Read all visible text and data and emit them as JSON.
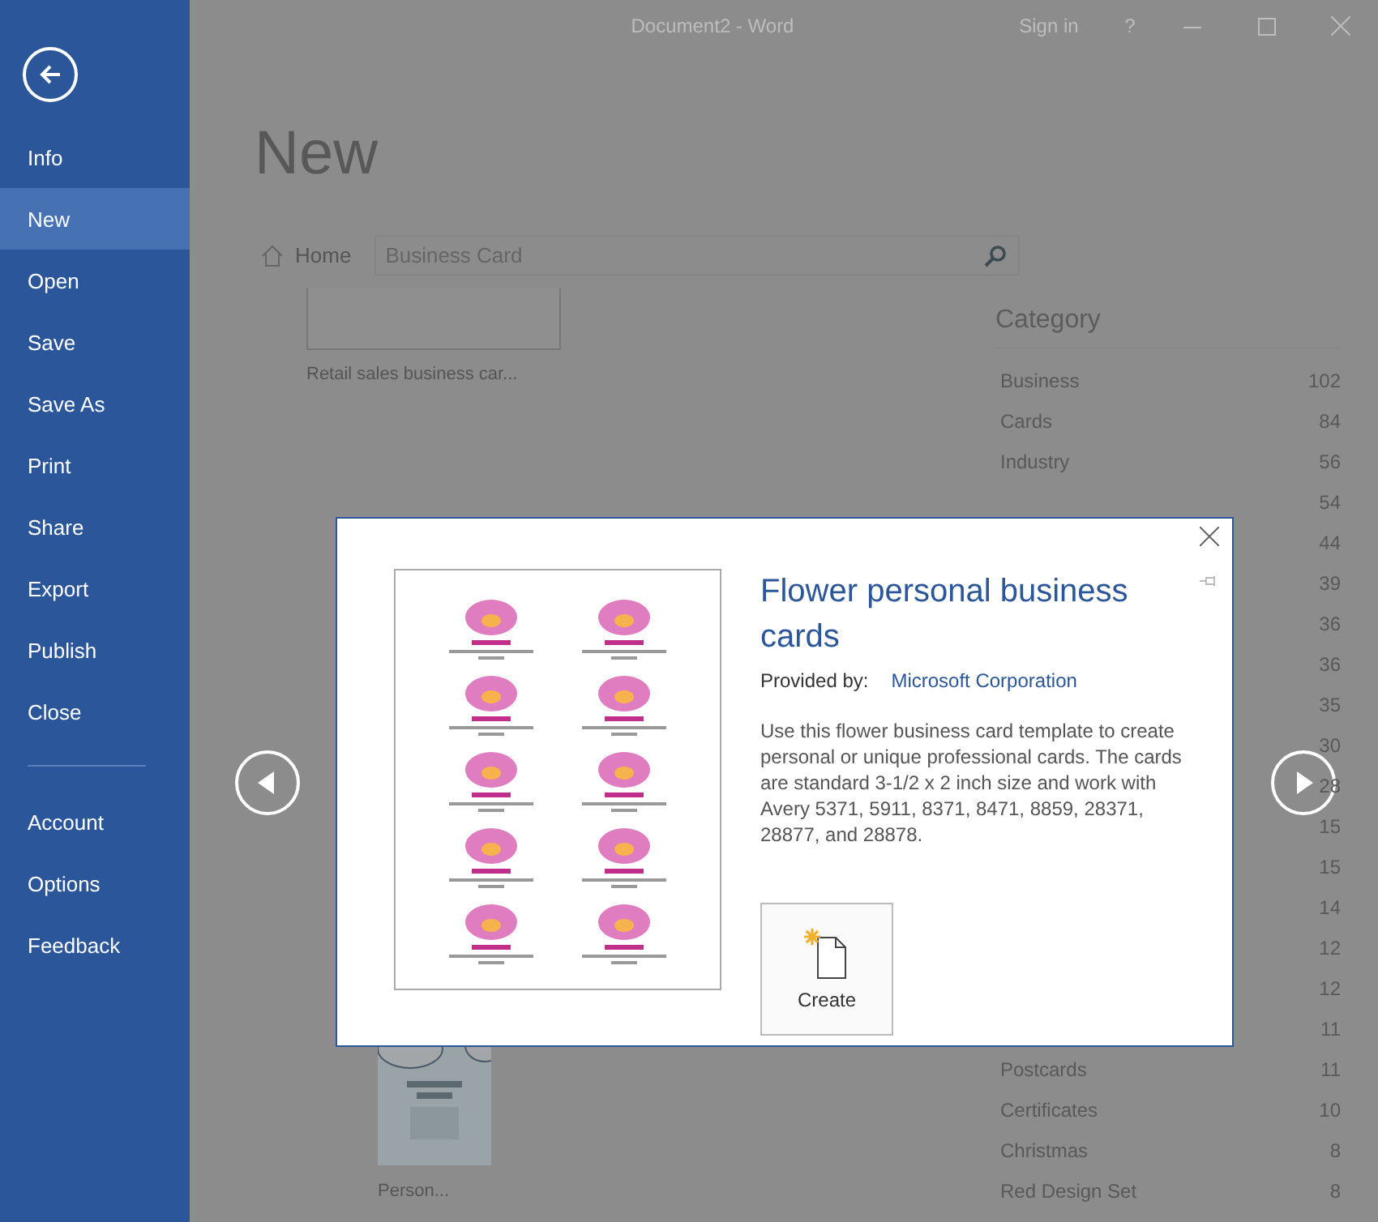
{
  "window": {
    "title": "Document2 - Word",
    "sign_in": "Sign in",
    "help": "?"
  },
  "sidebar": {
    "items": [
      {
        "label": "Info",
        "selected": false
      },
      {
        "label": "New",
        "selected": true
      },
      {
        "label": "Open",
        "selected": false
      },
      {
        "label": "Save",
        "selected": false
      },
      {
        "label": "Save As",
        "selected": false
      },
      {
        "label": "Print",
        "selected": false
      },
      {
        "label": "Share",
        "selected": false
      },
      {
        "label": "Export",
        "selected": false
      },
      {
        "label": "Publish",
        "selected": false
      },
      {
        "label": "Close",
        "selected": false
      }
    ],
    "footer_items": [
      {
        "label": "Account",
        "selected": false
      },
      {
        "label": "Options",
        "selected": false
      },
      {
        "label": "Feedback",
        "selected": false
      }
    ]
  },
  "page": {
    "heading": "New",
    "home": "Home",
    "search": {
      "value": "Business Card"
    }
  },
  "templates": [
    {
      "label": "Retail sales business car...",
      "kind": "plain"
    },
    {
      "label": "Person...",
      "kind": "cloud"
    }
  ],
  "category": {
    "title": "Category",
    "items": [
      {
        "name": "Business",
        "count": "102"
      },
      {
        "name": "Cards",
        "count": "84"
      },
      {
        "name": "Industry",
        "count": "56"
      },
      {
        "count": "54"
      },
      {
        "count": "44"
      },
      {
        "count": "39"
      },
      {
        "count": "36"
      },
      {
        "count": "36"
      },
      {
        "count": "35"
      },
      {
        "count": "30"
      },
      {
        "count": "28"
      },
      {
        "count": "15"
      },
      {
        "count": "15"
      },
      {
        "count": "14"
      },
      {
        "count": "12"
      },
      {
        "count": "12"
      },
      {
        "count": "11"
      },
      {
        "name": "Postcards",
        "count": "11"
      },
      {
        "name": "Certificates",
        "count": "10"
      },
      {
        "name": "Christmas",
        "count": "8"
      },
      {
        "name": "Red Design Set",
        "count": "8"
      }
    ]
  },
  "dialog": {
    "title": "Flower personal business cards",
    "provided_by_label": "Provided by:",
    "provider": "Microsoft Corporation",
    "description": "Use this flower business card template to create personal or unique professional cards. The cards are standard 3-1/2 x 2 inch size and work with Avery 5371, 5911, 8371, 8471, 8859, 28371, 28877, and 28878.",
    "create": "Create"
  }
}
